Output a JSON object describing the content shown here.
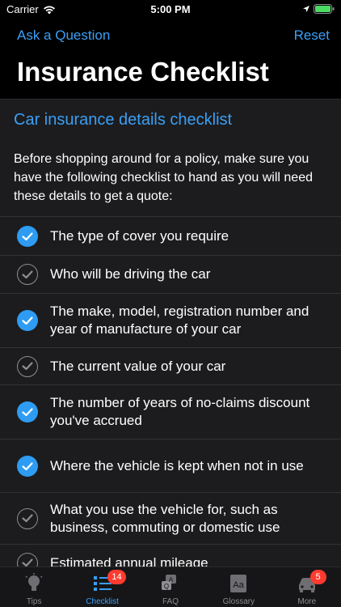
{
  "status_bar": {
    "carrier": "Carrier",
    "time": "5:00 PM"
  },
  "nav": {
    "left_button": "Ask a Question",
    "right_button": "Reset",
    "title": "Insurance Checklist"
  },
  "main": {
    "section_title": "Car insurance details checklist",
    "intro": "Before shopping around for a policy, make sure you have the following checklist to hand as you will need these details to get a quote:",
    "items": [
      {
        "label": "The type of cover you require",
        "checked": true
      },
      {
        "label": "Who will be driving the car",
        "checked": false
      },
      {
        "label": "The make, model, registration number and year of manufacture of your car",
        "checked": true
      },
      {
        "label": "The current value of your car",
        "checked": false
      },
      {
        "label": "The number of years of no-claims discount you've accrued",
        "checked": true
      },
      {
        "label": "Where the vehicle is kept when not in use",
        "checked": true
      },
      {
        "label": "What you use the vehicle for, such as business, commuting or domestic use",
        "checked": false
      },
      {
        "label": "Estimated annual mileage",
        "checked": false
      }
    ]
  },
  "tabs": [
    {
      "label": "Tips",
      "icon": "lightbulb-icon",
      "badge": ""
    },
    {
      "label": "Checklist",
      "icon": "checklist-icon",
      "badge": "14",
      "active": true
    },
    {
      "label": "FAQ",
      "icon": "faq-icon",
      "badge": ""
    },
    {
      "label": "Glossary",
      "icon": "glossary-icon",
      "badge": ""
    },
    {
      "label": "More",
      "icon": "car-icon",
      "badge": "5"
    }
  ],
  "colors": {
    "accent": "#3b9ff5",
    "check_on": "#2e9cf3",
    "badge": "#ff3b30",
    "background": "#000000",
    "content_bg": "#1c1c1e"
  }
}
